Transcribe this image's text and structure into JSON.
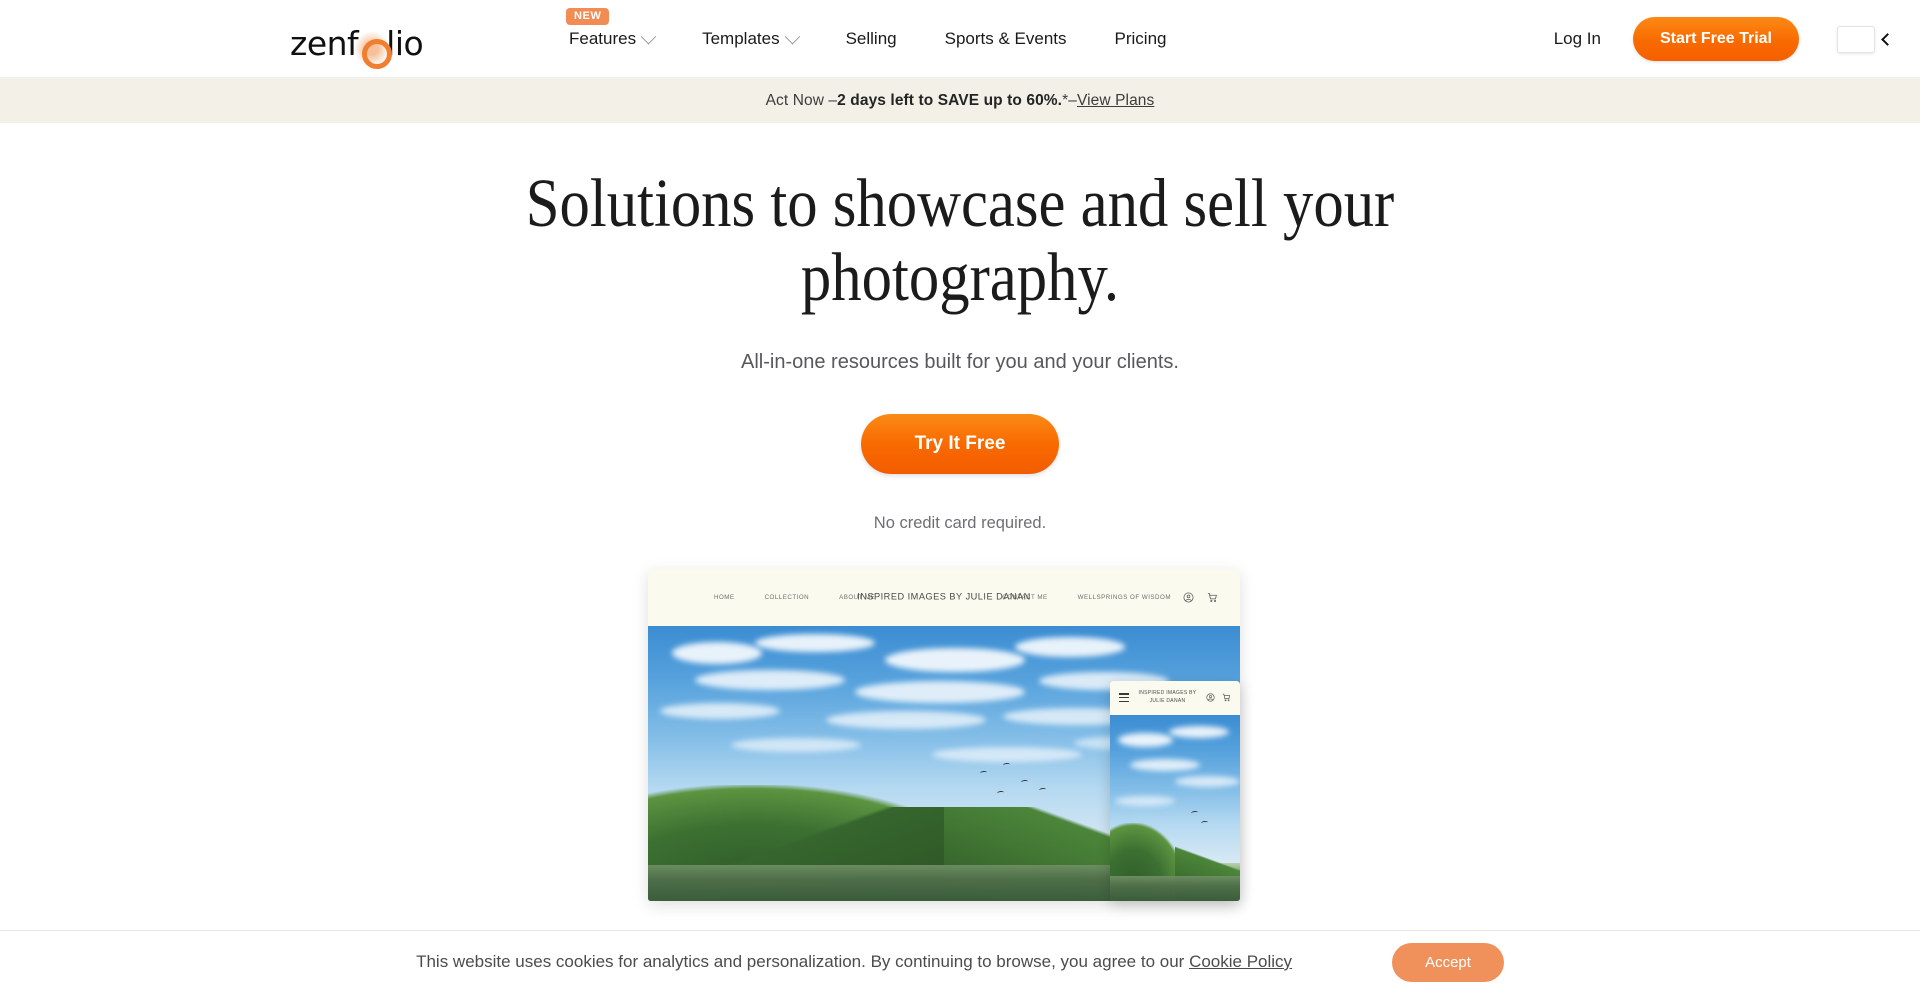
{
  "brand": {
    "logo_text_pre": "zenf",
    "logo_text_post": "lio",
    "accent_orange": "#F96A00",
    "badge_orange": "#F08C54",
    "banner_cream": "#F3F0E7"
  },
  "nav": {
    "items": [
      {
        "label": "Features",
        "badge": "NEW",
        "has_dropdown": true
      },
      {
        "label": "Templates",
        "badge": "",
        "has_dropdown": true
      },
      {
        "label": "Selling",
        "badge": "",
        "has_dropdown": false
      },
      {
        "label": "Sports & Events",
        "badge": "",
        "has_dropdown": false
      },
      {
        "label": "Pricing",
        "badge": "",
        "has_dropdown": false
      }
    ],
    "login_label": "Log In",
    "trial_label": "Start Free Trial",
    "locale_icon": "flag-icon",
    "locale_chevron": "chevron-left-icon"
  },
  "promo": {
    "lead": "Act Now – ",
    "bold": "2 days left to SAVE up to 60%.",
    "asterisk": "*",
    "separator": " – ",
    "link": "View Plans"
  },
  "hero": {
    "headline": "Solutions to showcase and sell your photography.",
    "subheadline": "All-in-one resources built for you and your clients.",
    "cta_label": "Try It Free",
    "disclaimer": "No credit card required."
  },
  "mockup": {
    "site_title": "INSPIRED IMAGES BY JULIE DANAN",
    "nav_left": [
      "HOME",
      "COLLECTION",
      "ABOUT ME"
    ],
    "nav_right": [
      "CONTACT ME",
      "WELLSPRINGS OF WISDOM"
    ],
    "icons": [
      "user-icon",
      "cart-icon"
    ],
    "mobile_menu_icon": "hamburger-icon",
    "photo_description": "River landscape with blue sky, white clouds, green tree-lined banks and birds"
  },
  "cookie": {
    "message": "This website uses cookies for analytics and personalization. By continuing to browse, you agree to our ",
    "policy_link": "Cookie Policy",
    "accept_label": "Accept"
  }
}
